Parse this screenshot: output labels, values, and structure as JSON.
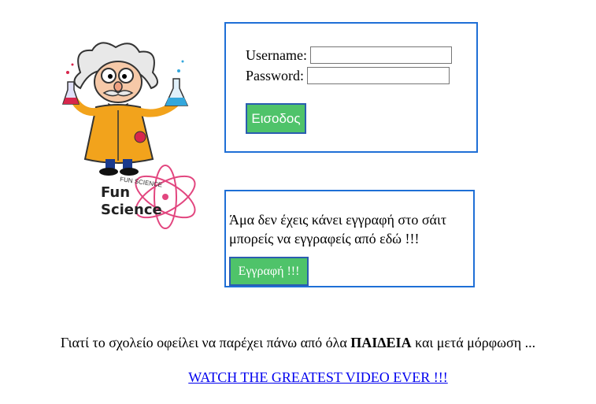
{
  "logo": {
    "line1": "Fun",
    "line2": "Science",
    "arc_text": "FUN SCIENCE"
  },
  "login": {
    "username_label": "Username:",
    "password_label": "Password:",
    "username_value": "",
    "password_value": "",
    "submit_label": "Εισοδος"
  },
  "register": {
    "text": "Άμα δεν έχεις κάνει εγγραφή στο σάιτ μπορείς να εγγραφείς από εδώ !!!",
    "button_label": "Εγγραφή !!!"
  },
  "footer": {
    "tagline_before": "Γιατί το σχολείο οφείλει να παρέχει πάνω από όλα ",
    "tagline_bold": "ΠΑΙΔΕΙΑ",
    "tagline_after": " και μετά μόρφωση ...",
    "video_link": "WATCH THE GREATEST VIDEO EVER !!!"
  },
  "colors": {
    "accent_border": "#1f6fd6",
    "button_green": "#4fc36a",
    "link": "#0000ee"
  }
}
